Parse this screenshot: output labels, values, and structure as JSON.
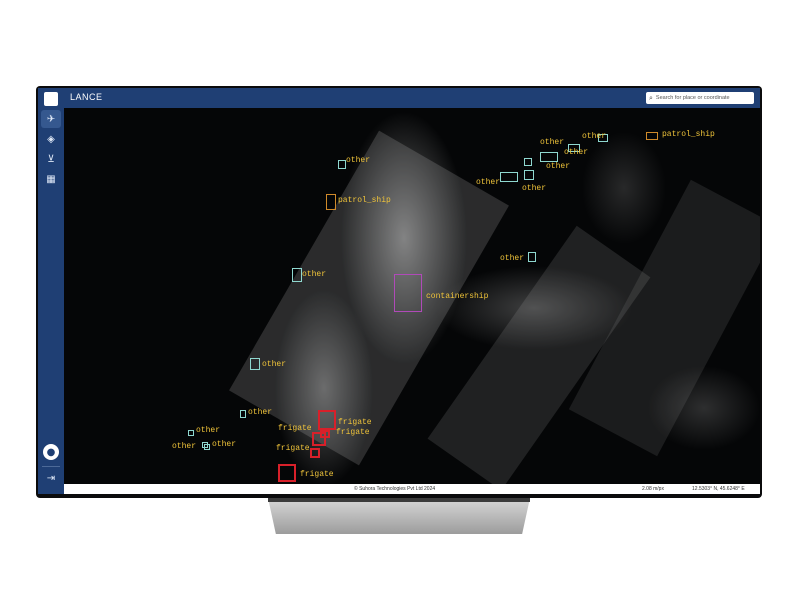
{
  "app": {
    "title": "LANCE",
    "search_placeholder": "Search for place or coordinate"
  },
  "sidebar": {
    "items": [
      {
        "icon": "satellite-icon",
        "active": true
      },
      {
        "icon": "layers-icon",
        "active": false
      },
      {
        "icon": "cart-icon",
        "active": false
      },
      {
        "icon": "calendar-icon",
        "active": false
      }
    ],
    "user_icon": "user-icon",
    "logout_icon": "logout-icon"
  },
  "footer": {
    "copyright": "© Suhora Technologies Pvt Ltd 2024",
    "scale": "2.08 m/px",
    "coordinates": "12.5303° N, 45.6248° E"
  },
  "colors": {
    "brand": "#1f3f74",
    "other_box": "#8fd8d0",
    "patrol_ship_box": "#d08a2a",
    "containership_box": "#b04ab8",
    "frigate_box": "#d8202a",
    "label_text": "#f0c43a"
  },
  "detections": [
    {
      "label": "other",
      "kind": "other"
    },
    {
      "label": "patrol_ship",
      "kind": "patrol_ship"
    },
    {
      "label": "other",
      "kind": "other"
    },
    {
      "label": "containership",
      "kind": "containership"
    },
    {
      "label": "other",
      "kind": "other"
    },
    {
      "label": "other",
      "kind": "other"
    },
    {
      "label": "other",
      "kind": "other"
    },
    {
      "label": "other",
      "kind": "other"
    },
    {
      "label": "other",
      "kind": "other"
    },
    {
      "label": "frigate",
      "kind": "frigate"
    },
    {
      "label": "frigate",
      "kind": "frigate"
    },
    {
      "label": "frigate",
      "kind": "frigate"
    },
    {
      "label": "frigate",
      "kind": "frigate"
    },
    {
      "label": "frigate",
      "kind": "frigate"
    },
    {
      "label": "other",
      "kind": "other"
    },
    {
      "label": "other",
      "kind": "other"
    },
    {
      "label": "other",
      "kind": "other"
    },
    {
      "label": "other",
      "kind": "other"
    },
    {
      "label": "other",
      "kind": "other"
    },
    {
      "label": "other",
      "kind": "other"
    },
    {
      "label": "other",
      "kind": "other"
    },
    {
      "label": "patrol_ship",
      "kind": "patrol_ship"
    }
  ]
}
